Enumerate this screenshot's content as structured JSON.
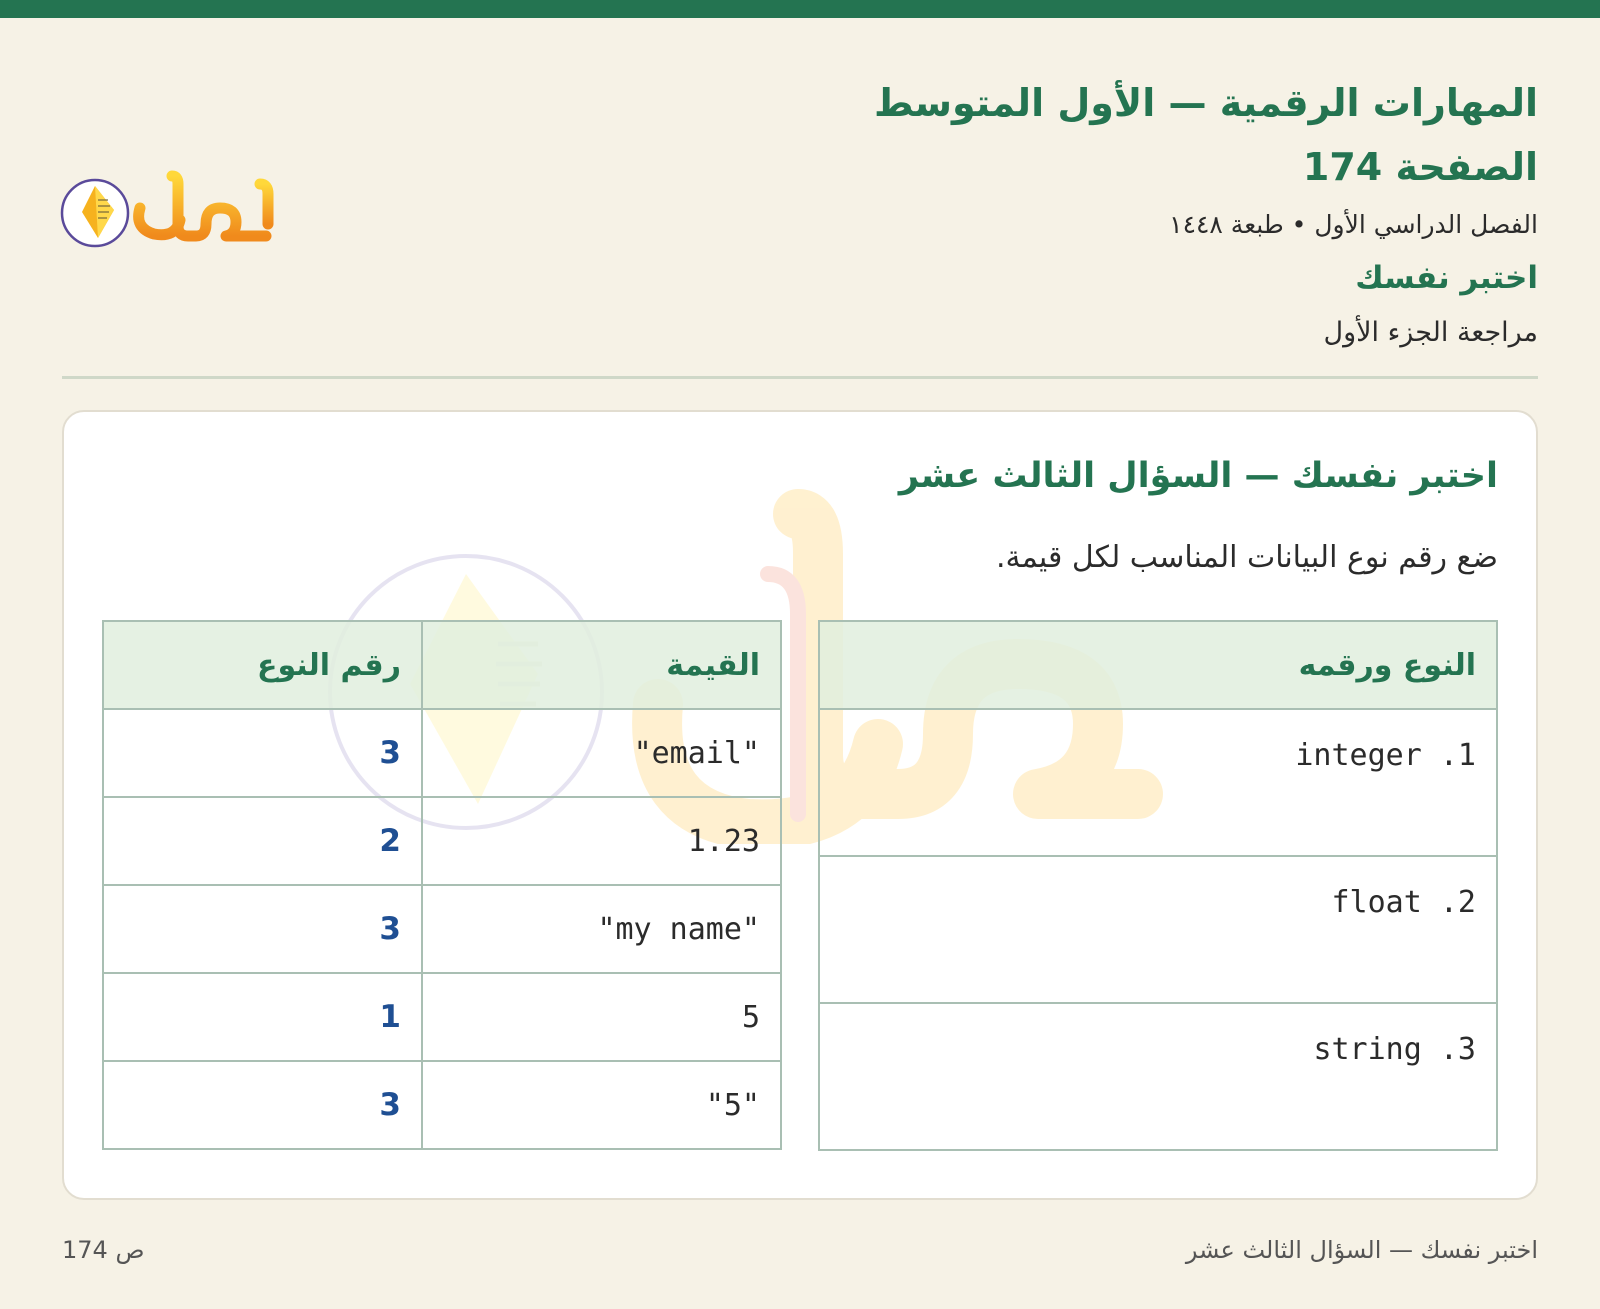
{
  "header": {
    "title": "المهارات الرقمية — الأول المتوسط",
    "page": "الصفحة 174",
    "term": "الفصل الدراسي الأول • طبعة ١٤٤٨",
    "section": "اختبر نفسك",
    "subsection": "مراجعة الجزء الأول"
  },
  "logo": {
    "text": "حلول"
  },
  "card": {
    "title": "اختبر نفسك — السؤال الثالث عشر",
    "prompt": "ضع رقم نوع البيانات المناسب لكل قيمة.",
    "types_table": {
      "header": "النوع ورقمه",
      "rows": [
        "integer .1",
        "float .2",
        "string .3"
      ]
    },
    "values_table": {
      "headers": [
        "القيمة",
        "رقم النوع"
      ],
      "rows": [
        {
          "value": "\"email\"",
          "type_number": "3"
        },
        {
          "value": "1.23",
          "type_number": "2"
        },
        {
          "value": "\"my name\"",
          "type_number": "3"
        },
        {
          "value": "5",
          "type_number": "1"
        },
        {
          "value": "\"5\"",
          "type_number": "3"
        }
      ]
    }
  },
  "footer": {
    "left": "ص 174",
    "right": "اختبر نفسك — السؤال الثالث عشر"
  },
  "colors": {
    "accent": "#247451",
    "answer": "#1f4f93",
    "background": "#f6f2e6"
  }
}
